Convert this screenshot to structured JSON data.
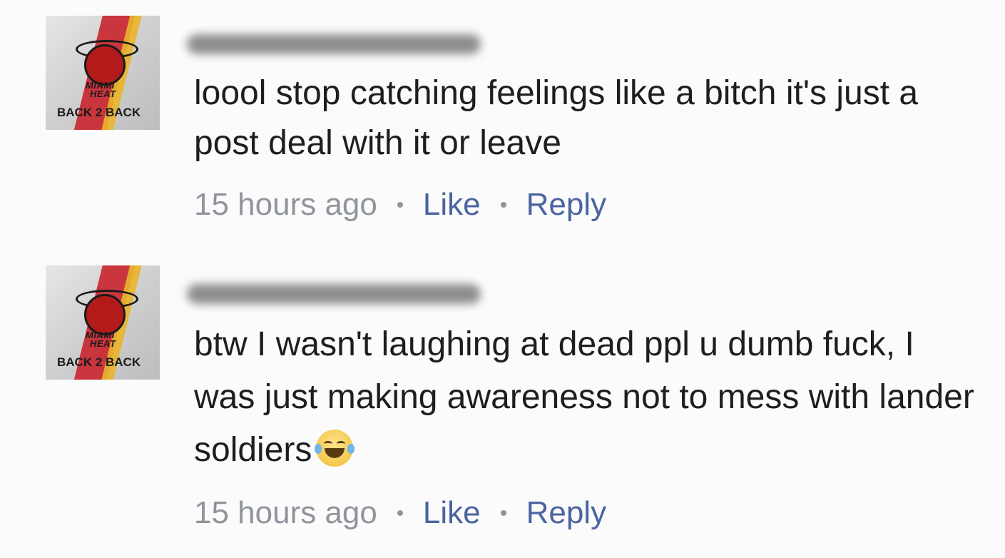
{
  "comments": [
    {
      "avatar": {
        "brand_line1": "MIAMI",
        "brand_line2": "HEAT",
        "tag": "BACK 2 BACK"
      },
      "text": "loool stop catching feelings like a bitch it's just a post deal with it or leave",
      "time": "15 hours ago",
      "like_label": "Like",
      "reply_label": "Reply"
    },
    {
      "avatar": {
        "brand_line1": "MIAMI",
        "brand_line2": "HEAT",
        "tag": "BACK 2 BACK"
      },
      "text": "btw I wasn't laughing at dead ppl u dumb fuck, I was just making awareness not to mess with lander soldiers",
      "emoji": "face-with-tears-of-joy",
      "time": "15 hours ago",
      "like_label": "Like",
      "reply_label": "Reply"
    }
  ]
}
